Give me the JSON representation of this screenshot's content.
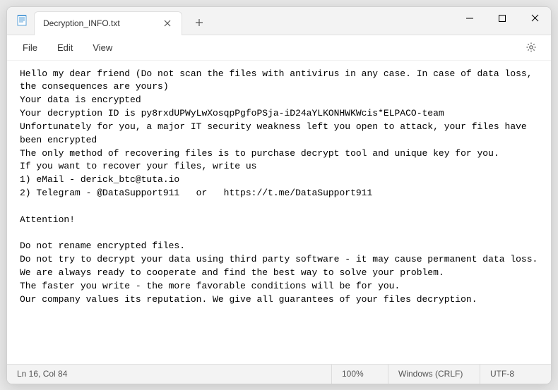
{
  "window": {
    "tab_title": "Decryption_INFO.txt"
  },
  "menu": {
    "file": "File",
    "edit": "Edit",
    "view": "View"
  },
  "content": {
    "body": "Hello my dear friend (Do not scan the files with antivirus in any case. In case of data loss, the consequences are yours)\nYour data is encrypted\nYour decryption ID is py8rxdUPWyLwXosqpPgfoPSja-iD24aYLKONHWKWcis*ELPACO-team\nUnfortunately for you, a major IT security weakness left you open to attack, your files have been encrypted\nThe only method of recovering files is to purchase decrypt tool and unique key for you.\nIf you want to recover your files, write us\n1) eMail - derick_btc@tuta.io\n2) Telegram - @DataSupport911   or   https://t.me/DataSupport911\n\nAttention!\n\nDo not rename encrypted files.\nDo not try to decrypt your data using third party software - it may cause permanent data loss.\nWe are always ready to cooperate and find the best way to solve your problem.\nThe faster you write - the more favorable conditions will be for you.\nOur company values its reputation. We give all guarantees of your files decryption."
  },
  "status": {
    "position": "Ln 16, Col 84",
    "zoom": "100%",
    "line_ending": "Windows (CRLF)",
    "encoding": "UTF-8"
  }
}
